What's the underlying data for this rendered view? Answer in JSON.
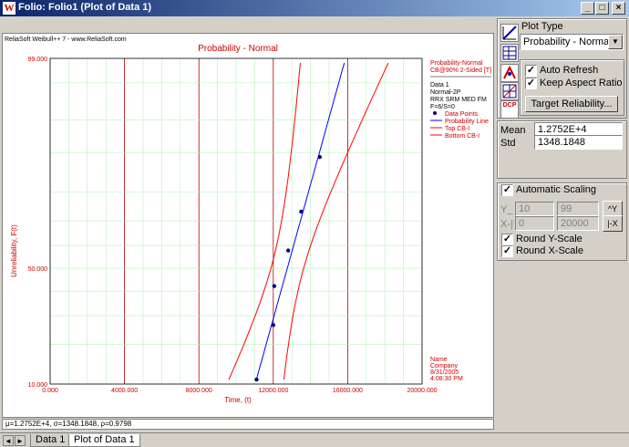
{
  "window": {
    "title": "Folio: Folio1 (Plot of Data 1)",
    "app_icon": "W",
    "buttons": {
      "minimize": "_",
      "maximize": "□",
      "close": "×"
    }
  },
  "plot": {
    "header_left": "ReliaSoft Weibull++ 7 - www.ReliaSoft.com",
    "title": "Probability - Normal",
    "xlabel": "Time, (t)",
    "ylabel": "Unreliability, F(t)",
    "legend": {
      "line1": "Probability-Normal",
      "line2": "CB@90% 2-Sided [T]",
      "dataset": "Data 1",
      "dist": "Normal-2P",
      "method": "RRX SRM MED FM",
      "counts": "F=6/S=0",
      "entries": [
        "Data Points",
        "Probability Line",
        "Top CB-I",
        "Bottom CB-I"
      ]
    },
    "footer": {
      "name": "Name",
      "company": "Company",
      "date": "8/31/2005",
      "time": "4:08:30 PM"
    },
    "status": "μ=1.2752E+4, σ=1348.1848, ρ=0.9798",
    "colors": {
      "axis_text": "#cc0000",
      "grid": "#b8f0b8",
      "vgrid_major": "#b00000",
      "fit": "#0000ff",
      "cb": "#ff0000",
      "points": "#000080"
    }
  },
  "chart_data": {
    "type": "scatter",
    "title": "Probability - Normal",
    "xlabel": "Time, (t)",
    "ylabel": "Unreliability, F(t)",
    "xlim": [
      0,
      20000
    ],
    "ylim": [
      10,
      99
    ],
    "xticks": [
      "0.000",
      "4000.000",
      "8000.000",
      "12000.000",
      "16000.000",
      "20000.000"
    ],
    "yticks": [
      "99.000",
      "50.000",
      "10.000"
    ],
    "points_x": [
      11100,
      12000,
      12050,
      12800,
      13500,
      14500
    ],
    "points_y": [
      10.9,
      26.5,
      42.2,
      57.8,
      73.5,
      89.1
    ],
    "mean": 12752,
    "std": 1348.1848
  },
  "tabs": {
    "items": [
      "Data 1",
      "Plot of Data 1"
    ],
    "active": 1,
    "nav_prev": "◄",
    "nav_next": "►"
  },
  "panel": {
    "plot_type_label": "Plot Type",
    "plot_type_value": "Probability - Normal",
    "auto_refresh": "Auto Refresh",
    "keep_aspect": "Keep Aspect Ratio",
    "target_btn": "Target Reliability...",
    "mean_label": "Mean",
    "mean_value": "1.2752E+4",
    "std_label": "Std",
    "std_value": "1348.1848",
    "auto_scaling": "Automatic Scaling",
    "y_label": "Y_",
    "y_min": "10",
    "y_max": "99",
    "y_btn": "^Y",
    "x_label": "X-|",
    "x_min": "0",
    "x_max": "20000",
    "x_btn": "|-X",
    "round_y": "Round Y-Scale",
    "round_x": "Round X-Scale",
    "icon_dcp_text": "DCP",
    "check_mark": "✓"
  }
}
